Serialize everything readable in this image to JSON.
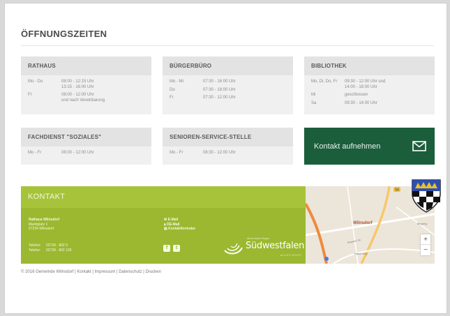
{
  "section_title": "ÖFFNUNGSZEITEN",
  "cards": [
    {
      "title": "RATHAUS",
      "rows": [
        {
          "day": "Mo - Do",
          "time": "08:00 - 12:15 Uhr\n13:15 - 16:00 Uhr"
        },
        {
          "day": "Fr",
          "time": "08:00 - 12:00 Uhr\nund nach Vereinbarung"
        }
      ]
    },
    {
      "title": "BÜRGERBÜRO",
      "rows": [
        {
          "day": "Mo - Mi",
          "time": "07:30 - 16:00 Uhr"
        },
        {
          "day": "Do",
          "time": "07:30 - 18:00 Uhr"
        },
        {
          "day": "Fr",
          "time": "07:30 - 12:00 Uhr"
        }
      ]
    },
    {
      "title": "BIBLIOTHEK",
      "rows": [
        {
          "day": "Mo, Di, Do, Fr",
          "time": "09:30 - 12:00 Uhr und\n14:00 - 18:00 Uhr"
        },
        {
          "day": "Mi",
          "time": "geschlossen"
        },
        {
          "day": "Sa",
          "time": "09:30 - 14:00 Uhr"
        }
      ]
    },
    {
      "title": "FACHDIENST \"SOZIALES\"",
      "rows": [
        {
          "day": "Mo - Fr",
          "time": "08:00 - 12:00 Uhr"
        }
      ]
    },
    {
      "title": "SENIOREN-SERVICE-STELLE",
      "rows": [
        {
          "day": "Mo - Fr",
          "time": "08:30 - 12:00 Uhr"
        }
      ]
    }
  ],
  "cta": {
    "label": "Kontakt aufnehmen",
    "icon": "mail-icon"
  },
  "contact": {
    "title": "KONTAKT",
    "address": {
      "name": "Rathaus Wilnsdorf",
      "street": "Marktplatz 1",
      "city": "57234 Wilnsdorf"
    },
    "phone": [
      {
        "label": "Telefon:",
        "value": "02739 - 802 0"
      },
      {
        "label": "Telefax:",
        "value": "02739 - 802 139"
      }
    ],
    "links": [
      "E-Mail",
      "DE-Mail",
      "Kontaktformular"
    ],
    "social": [
      {
        "name": "facebook-icon",
        "glyph": "f"
      },
      {
        "name": "twitter-icon",
        "glyph": "t"
      }
    ],
    "logo": {
      "small": "Meine starke Region",
      "name": "Südwestfalen",
      "tagline": "ALLES ECHT!"
    },
    "color": "#9bb830"
  },
  "map": {
    "place_label": "Wilnsdorf",
    "road_labels": [
      "Bergweg",
      "Siegener Str.",
      "Hainer Weg"
    ],
    "route_badge": "54",
    "zoom_in": "+",
    "zoom_out": "−"
  },
  "footer": {
    "copyright": "© 2016 Gemeinde Wilnsdorf",
    "links": [
      "Kontakt",
      "Impressum",
      "Datenschutz",
      "Drucken"
    ]
  },
  "colors": {
    "cta_bg": "#1b5e3c",
    "contact_bg": "#9bb830",
    "card_head": "#e3e3e3"
  }
}
